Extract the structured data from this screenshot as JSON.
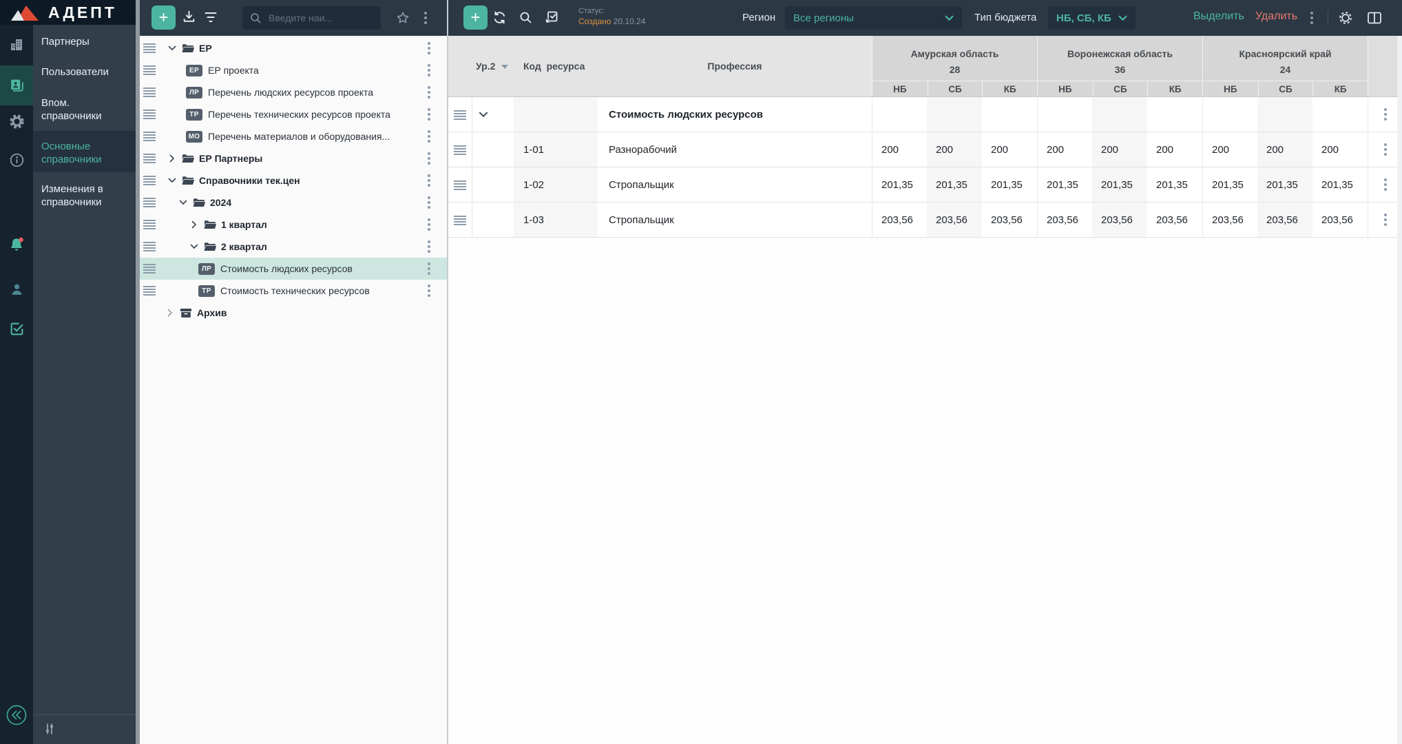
{
  "logo": {
    "title": "АДЕПТ"
  },
  "menu": {
    "items": [
      {
        "label": "Партнеры"
      },
      {
        "label": "Пользователи"
      },
      {
        "label": "Впом. справочники"
      },
      {
        "label": "Основные справочники"
      },
      {
        "label": "Изменения в справочники"
      }
    ]
  },
  "tree_toolbar": {
    "search_placeholder": "Введите наи..."
  },
  "tree": {
    "items": [
      {
        "label": "ЕР"
      },
      {
        "badge": "ЕР",
        "label": "ЕР проекта"
      },
      {
        "badge": "ЛР",
        "label": "Перечень людских ресурсов проекта"
      },
      {
        "badge": "ТР",
        "label": "Перечень технических ресурсов проекта"
      },
      {
        "badge": "МО",
        "label": "Перечень материалов и оборудования..."
      },
      {
        "label": "ЕР Партнеры"
      },
      {
        "label": "Справочники тек.цен"
      },
      {
        "label": "2024"
      },
      {
        "label": "1 квартал"
      },
      {
        "label": "2 квартал"
      },
      {
        "badge": "ЛР",
        "label": "Стоимость людских ресурсов"
      },
      {
        "badge": "ТР",
        "label": "Стоимость технических ресурсов"
      },
      {
        "label": "Архив"
      }
    ]
  },
  "toolbar": {
    "status_label": "Статус:",
    "status_value": "Создано",
    "status_date": "20.10.24",
    "region_label": "Регион",
    "region_value": "Все регионы",
    "budget_label": "Тип бюджета",
    "budget_value": "НБ, СБ, КБ",
    "select_label": "Выделить",
    "delete_label": "Удалить"
  },
  "table": {
    "header": {
      "level": "Ур.2",
      "code": "Код  ресурса",
      "profession": "Профессия"
    },
    "regions": [
      {
        "name": "Амурская область",
        "count": "28",
        "cols": [
          "НБ",
          "СБ",
          "КБ"
        ]
      },
      {
        "name": "Воронежская область",
        "count": "36",
        "cols": [
          "НБ",
          "СБ",
          "КБ"
        ]
      },
      {
        "name": "Красноярский край",
        "count": "24",
        "cols": [
          "НБ",
          "СБ",
          "КБ"
        ]
      }
    ],
    "group": {
      "title": "Стоимость людских ресурсов"
    },
    "rows": [
      {
        "code": "1-01",
        "profession": "Разнорабочий",
        "values": [
          "200",
          "200",
          "200",
          "200",
          "200",
          "200",
          "200",
          "200",
          "200"
        ]
      },
      {
        "code": "1-02",
        "profession": "Стропальщик",
        "values": [
          "201,35",
          "201,35",
          "201,35",
          "201,35",
          "201,35",
          "201,35",
          "201,35",
          "201,35",
          "201,35"
        ]
      },
      {
        "code": "1-03",
        "profession": "Стропальщик",
        "values": [
          "203,56",
          "203,56",
          "203,56",
          "203,56",
          "203,56",
          "203,56",
          "203,56",
          "203,56",
          "203,56"
        ]
      }
    ]
  },
  "colors": {
    "accent": "#4CB5A1",
    "danger": "#E8796F",
    "status_orange": "#DF913C",
    "selection": "#CDE7E0"
  },
  "icons": {
    "rail": [
      "buildings",
      "documents",
      "settings",
      "info",
      "notifications",
      "user",
      "checklist",
      "collapse"
    ],
    "tree_toolbar": [
      "plus",
      "download",
      "filter",
      "search",
      "star",
      "kebab"
    ],
    "main_toolbar": [
      "plus",
      "refresh",
      "search",
      "validate",
      "kebab",
      "settings",
      "split-view"
    ]
  }
}
